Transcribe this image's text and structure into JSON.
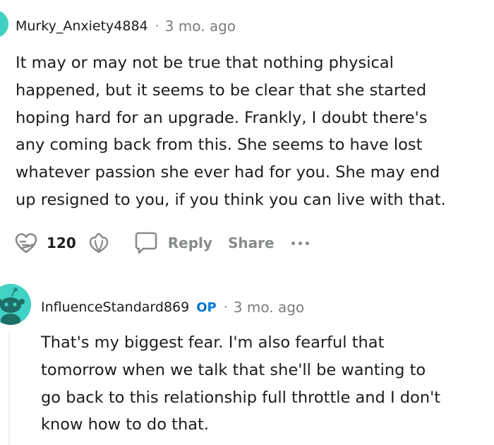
{
  "comments": [
    {
      "username": "Murky_Anxiety4884",
      "separator": "·",
      "time": "3 mo. ago",
      "body_lines": [
        "It may or may not be true that nothing physical",
        "happened, but it seems to be clear that she started",
        "hoping hard for an upgrade. Frankly, I doubt there's",
        "any coming back from this. She seems to have lost",
        "whatever passion she ever had for you. She may end",
        "up resigned to you, if you think you can live with that."
      ],
      "actions": {
        "vote_count": "120",
        "reply_label": "Reply",
        "share_label": "Share"
      },
      "icons": [
        "upvote-heart-icon",
        "downvote-icon",
        "comment-bubble-icon",
        "more-dots-icon"
      ]
    },
    {
      "username": "InfluenceStandard869",
      "op_badge": "OP",
      "separator": "·",
      "time": "3 mo. ago",
      "body_lines": [
        "That's my biggest fear. I'm also fearful that",
        "tomorrow when we talk that she'll be wanting to",
        "go back to this relationship full throttle and I don't",
        "know how to do that."
      ],
      "icons": [
        "snoo-avatar-icon"
      ]
    }
  ],
  "colors": {
    "avatar_bg": "#3fd3c6",
    "meta_gray": "#878a8c",
    "op_blue": "#0079d3",
    "text": "#1c1c1c"
  }
}
